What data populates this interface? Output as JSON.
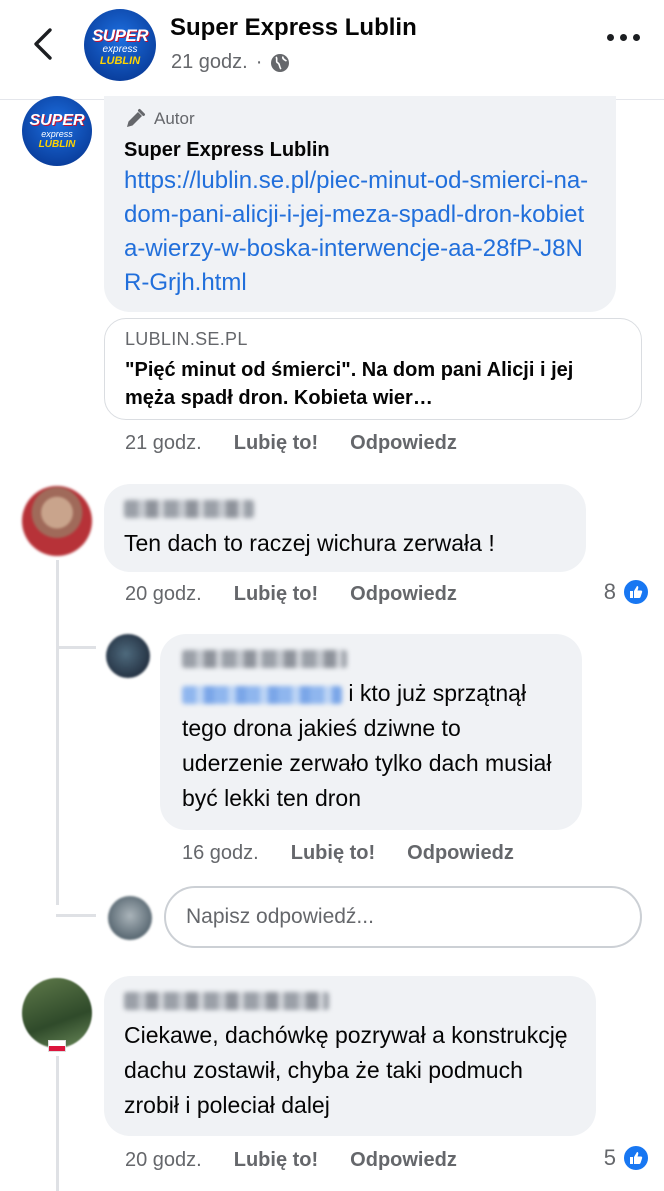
{
  "header": {
    "title": "Super Express Lublin",
    "time": "21 godz.",
    "separator": "·",
    "logo_line1": "SUPER",
    "logo_line2": "express",
    "logo_line3": "LUBLIN"
  },
  "comments": [
    {
      "badge": "Autor",
      "author": "Super Express Lublin",
      "link": "https://lublin.se.pl/piec-minut-od-smierci-na-dom-pani-alicji-i-jej-meza-spadl-dron-kobieta-wierzy-w-boska-interwencje-aa-28fP-J8NR-Grjh.html",
      "preview_domain": "LUBLIN.SE.PL",
      "preview_title": "\"Pięć minut od śmierci\". Na dom pani Alicji i jej męża spadł dron. Kobieta wier…",
      "time": "21 godz.",
      "like_label": "Lubię to!",
      "reply_label": "Odpowiedz"
    },
    {
      "text": "Ten dach to raczej wichura zerwała !",
      "time": "20 godz.",
      "like_label": "Lubię to!",
      "reply_label": "Odpowiedz",
      "reactions": "8"
    },
    {
      "text_after_mention": "i kto już sprzątnął",
      "text_rest": "tego drona jakieś dziwne to uderzenie zerwało tylko dach musiał być lekki ten dron",
      "time": "16 godz.",
      "like_label": "Lubię to!",
      "reply_label": "Odpowiedz"
    },
    {
      "text": "Ciekawe, dachówkę pozrywał a konstrukcję dachu zostawił, chyba że taki podmuch zrobił i poleciał dalej",
      "time": "20 godz.",
      "like_label": "Lubię to!",
      "reply_label": "Odpowiedz",
      "reactions": "5"
    }
  ],
  "reply_input": {
    "placeholder": "Napisz odpowiedź..."
  },
  "colors": {
    "link": "#216fdb",
    "bubble": "#f0f2f5",
    "muted": "#65676b",
    "like": "#1877f2"
  }
}
